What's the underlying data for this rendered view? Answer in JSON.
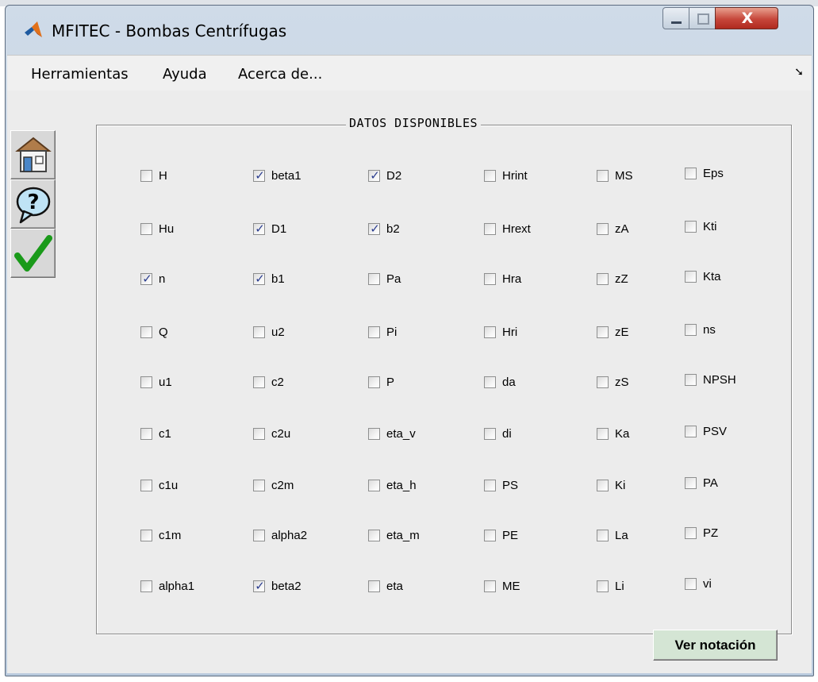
{
  "window": {
    "title": "MFITEC - Bombas Centrífugas",
    "close_symbol": "X"
  },
  "menu": {
    "items": [
      "Herramientas",
      "Ayuda",
      "Acerca de..."
    ],
    "overflow_symbol": "➘"
  },
  "toolbar": {
    "icons": [
      "home-icon",
      "help-icon",
      "checkmark-icon"
    ]
  },
  "panel": {
    "title": "DATOS DISPONIBLES"
  },
  "checkboxes": [
    [
      {
        "label": "H",
        "checked": false
      },
      {
        "label": "beta1",
        "checked": true
      },
      {
        "label": "D2",
        "checked": true
      },
      {
        "label": "Hrint",
        "checked": false
      },
      {
        "label": "MS",
        "checked": false
      },
      {
        "label": "Eps",
        "checked": false
      }
    ],
    [
      {
        "label": "Hu",
        "checked": false
      },
      {
        "label": "D1",
        "checked": true
      },
      {
        "label": "b2",
        "checked": true
      },
      {
        "label": "Hrext",
        "checked": false
      },
      {
        "label": "zA",
        "checked": false
      },
      {
        "label": "Kti",
        "checked": false
      }
    ],
    [
      {
        "label": "n",
        "checked": true
      },
      {
        "label": "b1",
        "checked": true
      },
      {
        "label": "Pa",
        "checked": false
      },
      {
        "label": "Hra",
        "checked": false
      },
      {
        "label": "zZ",
        "checked": false
      },
      {
        "label": "Kta",
        "checked": false
      }
    ],
    [
      {
        "label": "Q",
        "checked": false
      },
      {
        "label": "u2",
        "checked": false
      },
      {
        "label": "Pi",
        "checked": false
      },
      {
        "label": "Hri",
        "checked": false
      },
      {
        "label": "zE",
        "checked": false
      },
      {
        "label": "ns",
        "checked": false
      }
    ],
    [
      {
        "label": "u1",
        "checked": false
      },
      {
        "label": "c2",
        "checked": false
      },
      {
        "label": "P",
        "checked": false
      },
      {
        "label": "da",
        "checked": false
      },
      {
        "label": "zS",
        "checked": false
      },
      {
        "label": "NPSH",
        "checked": false
      }
    ],
    [
      {
        "label": "c1",
        "checked": false
      },
      {
        "label": "c2u",
        "checked": false
      },
      {
        "label": "eta_v",
        "checked": false
      },
      {
        "label": "di",
        "checked": false
      },
      {
        "label": "Ka",
        "checked": false
      },
      {
        "label": "PSV",
        "checked": false
      }
    ],
    [
      {
        "label": "c1u",
        "checked": false
      },
      {
        "label": "c2m",
        "checked": false
      },
      {
        "label": "eta_h",
        "checked": false
      },
      {
        "label": "PS",
        "checked": false
      },
      {
        "label": "Ki",
        "checked": false
      },
      {
        "label": "PA",
        "checked": false
      }
    ],
    [
      {
        "label": "c1m",
        "checked": false
      },
      {
        "label": "alpha2",
        "checked": false
      },
      {
        "label": "eta_m",
        "checked": false
      },
      {
        "label": "PE",
        "checked": false
      },
      {
        "label": "La",
        "checked": false
      },
      {
        "label": "PZ",
        "checked": false
      }
    ],
    [
      {
        "label": "alpha1",
        "checked": false
      },
      {
        "label": "beta2",
        "checked": true
      },
      {
        "label": "eta",
        "checked": false
      },
      {
        "label": "ME",
        "checked": false
      },
      {
        "label": "Li",
        "checked": false
      },
      {
        "label": "vi",
        "checked": false
      }
    ]
  ],
  "buttons": {
    "ver_notacion": "Ver notación"
  }
}
